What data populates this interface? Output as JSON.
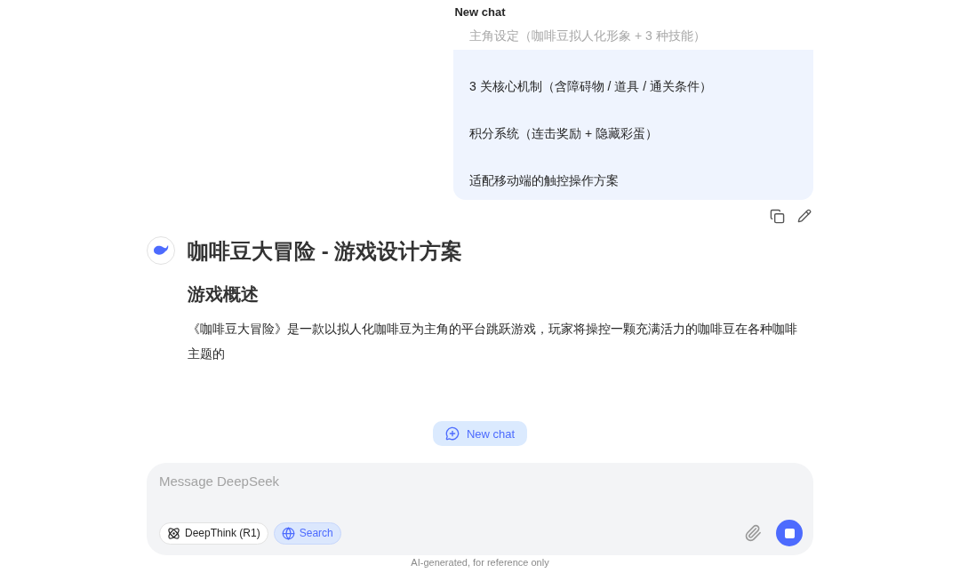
{
  "header": {
    "title": "New chat"
  },
  "user_message": {
    "items": [
      {
        "text": "主角设定（咖啡豆拟人化形象 + 3 种技能）",
        "faded": true
      },
      {
        "text": "3 关核心机制（含障碍物 / 道具 / 通关条件）",
        "faded": false
      },
      {
        "text": "积分系统（连击奖励 + 隐藏彩蛋）",
        "faded": false
      },
      {
        "text": "适配移动端的触控操作方案",
        "faded": false
      }
    ]
  },
  "assistant_message": {
    "title": "咖啡豆大冒险 - 游戏设计方案",
    "heading": "游戏概述",
    "paragraph": "《咖啡豆大冒险》是一款以拟人化咖啡豆为主角的平台跳跃游戏，玩家将操控一颗充满活力的咖啡豆在各种咖啡主题的"
  },
  "new_chat_button": {
    "label": "New chat"
  },
  "composer": {
    "placeholder": "Message DeepSeek",
    "toggles": [
      {
        "kind": "think",
        "label": "DeepThink (R1)",
        "selected": false
      },
      {
        "kind": "search",
        "label": "Search",
        "selected": true
      }
    ],
    "generating": true
  },
  "footer": {
    "text": "AI-generated, for reference only"
  }
}
